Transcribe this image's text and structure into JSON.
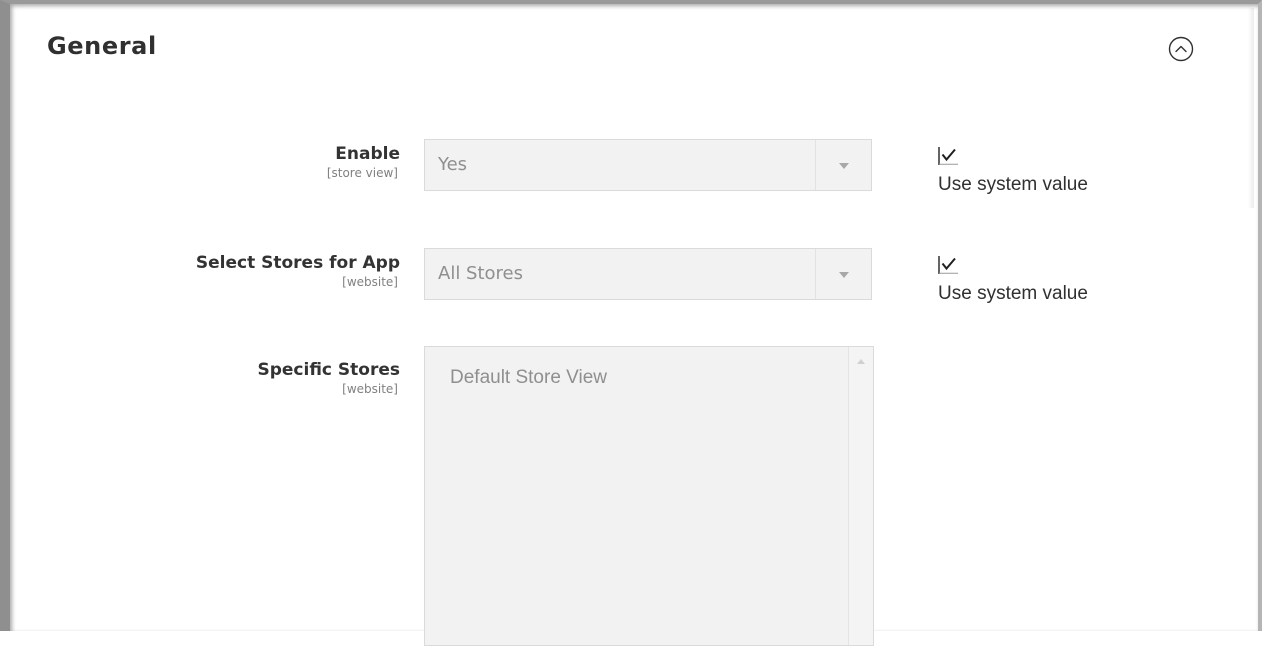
{
  "section": {
    "title": "General",
    "collapse_icon": "chevron-up-circle-icon"
  },
  "fields": {
    "enable": {
      "label": "Enable",
      "scope": "[store view]",
      "value": "Yes",
      "use_system_value": true,
      "use_system_value_label": "Use system value"
    },
    "select_stores": {
      "label": "Select Stores for App",
      "scope": "[website]",
      "value": "All Stores",
      "use_system_value": true,
      "use_system_value_label": "Use system value"
    },
    "specific_stores": {
      "label": "Specific Stores",
      "scope": "[website]",
      "options": [
        "Default Store View"
      ]
    }
  },
  "colors": {
    "disabled_field_bg": "#f2f2f2",
    "disabled_text": "#8f8f8f",
    "label_text": "#333333"
  }
}
